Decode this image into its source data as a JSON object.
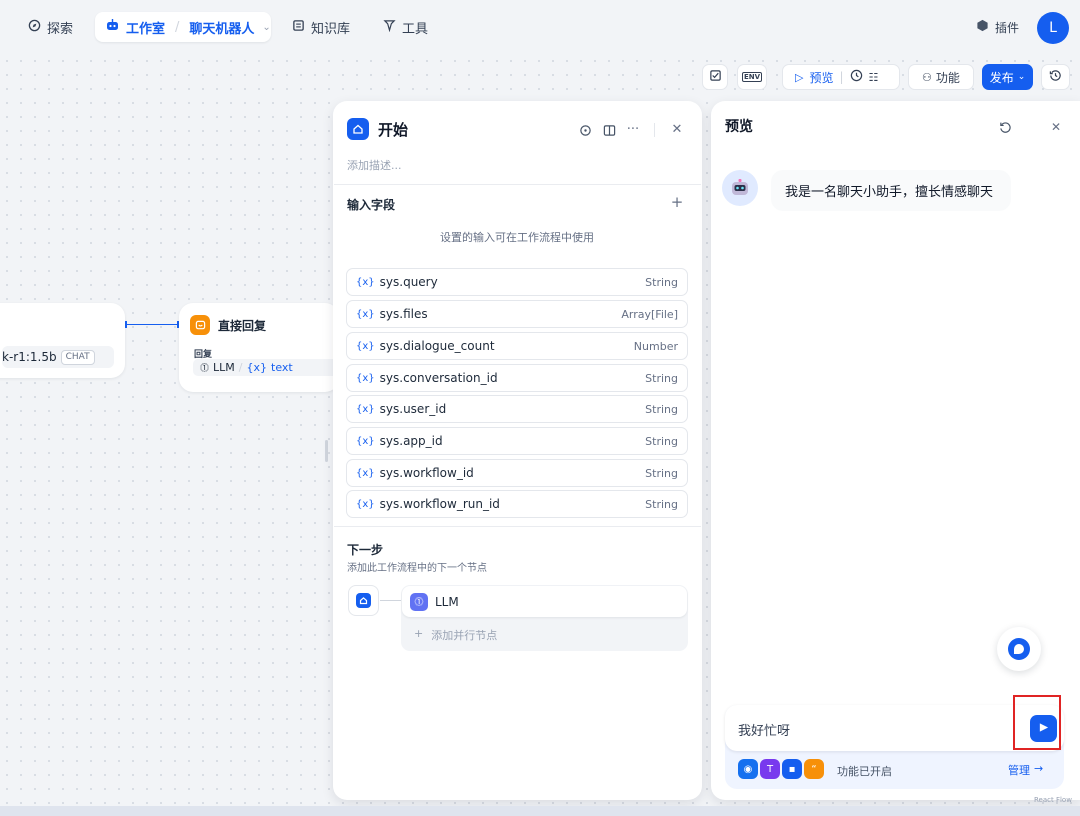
{
  "nav": {
    "explore": "探索",
    "studio": "工作室",
    "app_name": "聊天机器人",
    "knowledge": "知识库",
    "tools": "工具",
    "plugins": "插件",
    "avatar_letter": "L"
  },
  "toolbar": {
    "preview": "预览",
    "features": "功能",
    "publish": "发布",
    "env_label": "ENV"
  },
  "canvas": {
    "prev_node_model": "k-r1:1.5b",
    "prev_node_chip": "CHAT",
    "answer_node": {
      "title": "直接回复",
      "reply_label": "回复",
      "var_source": "LLM",
      "var_name": "text"
    },
    "watermark": "React Flow"
  },
  "start_panel": {
    "title": "开始",
    "description_placeholder": "添加描述...",
    "input_fields_title": "输入字段",
    "input_fields_hint": "设置的输入可在工作流程中使用",
    "variables": [
      {
        "name": "sys.query",
        "type": "String"
      },
      {
        "name": "sys.files",
        "type": "Array[File]"
      },
      {
        "name": "sys.dialogue_count",
        "type": "Number"
      },
      {
        "name": "sys.conversation_id",
        "type": "String"
      },
      {
        "name": "sys.user_id",
        "type": "String"
      },
      {
        "name": "sys.app_id",
        "type": "String"
      },
      {
        "name": "sys.workflow_id",
        "type": "String"
      },
      {
        "name": "sys.workflow_run_id",
        "type": "String"
      }
    ],
    "next_step_title": "下一步",
    "next_step_hint": "添加此工作流程中的下一个节点",
    "next_node": "LLM",
    "add_parallel": "添加并行节点"
  },
  "preview_panel": {
    "title": "预览",
    "bot_message": "我是一名聊天小助手，擅长情感聊天",
    "input_text": "我好忙呀",
    "features_enabled": "功能已开启",
    "manage": "管理"
  },
  "colors": {
    "accent": "#155eef",
    "answer_node_icon": "#f79009",
    "llm_icon": "#6172f3",
    "highlight_box": "#e02424"
  }
}
